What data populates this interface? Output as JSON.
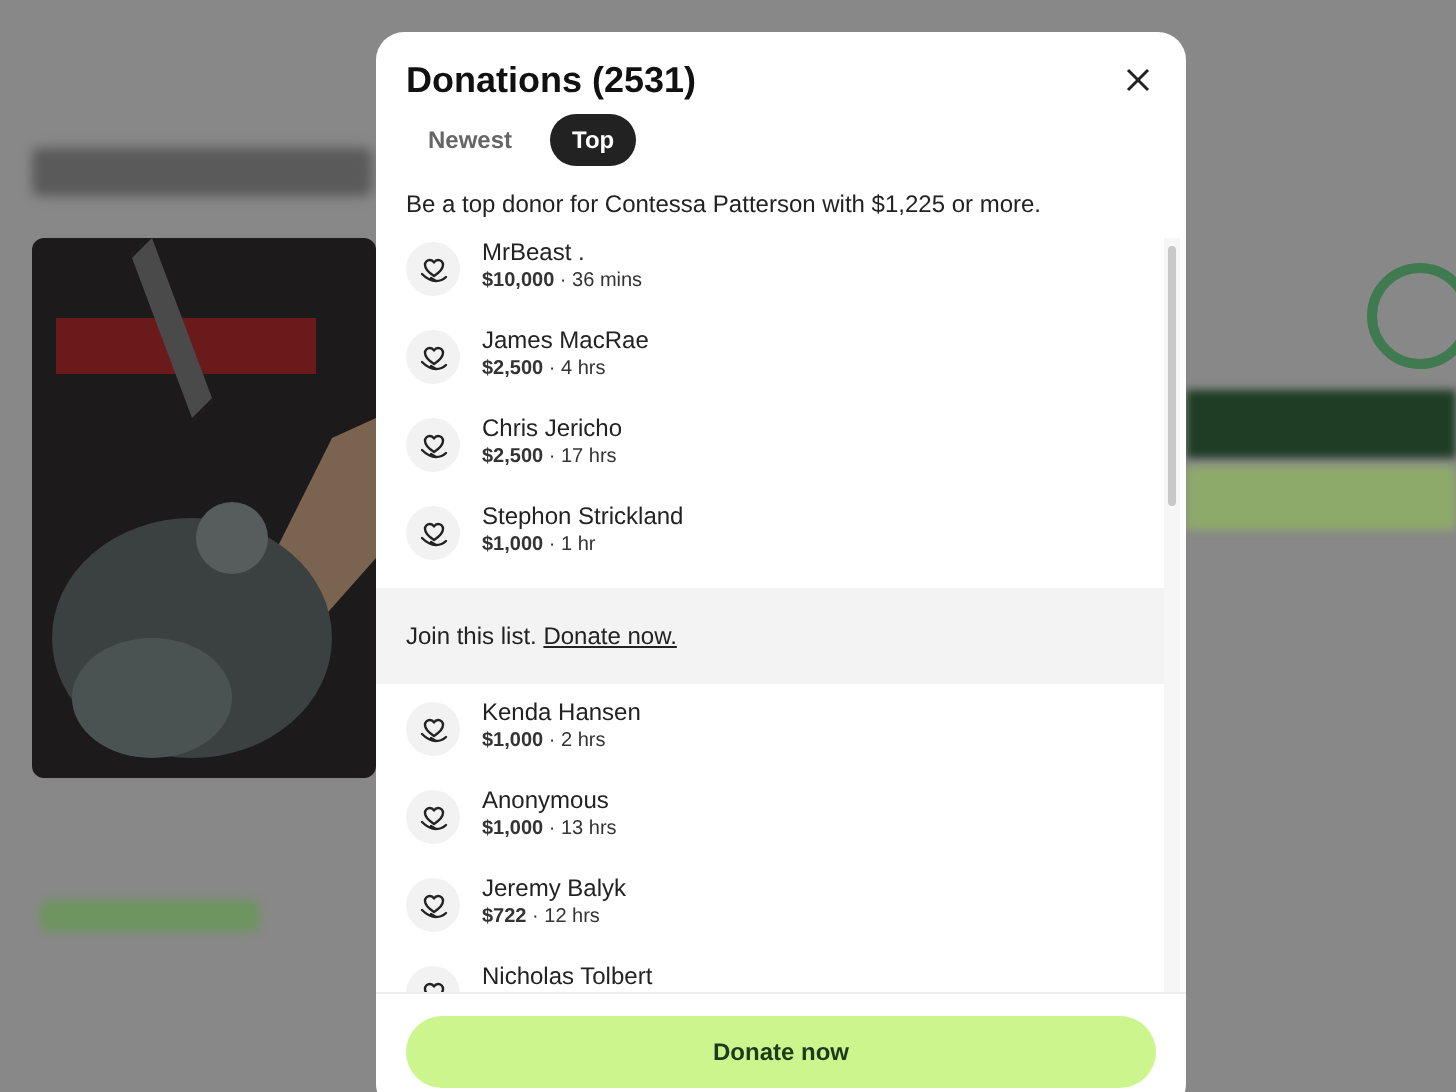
{
  "dialog": {
    "title": "Donations (2531)",
    "tabs": [
      {
        "label": "Newest",
        "selected": false
      },
      {
        "label": "Top",
        "selected": true
      }
    ],
    "description": "Be a top donor for Contessa Patterson with $1,225 or more.",
    "list": [
      {
        "kind": "donor",
        "name": "MrBeast .",
        "details": "**$10,000** · 36 mins"
      },
      {
        "kind": "donor",
        "name": "James MacRae",
        "details": "**$2,500** · 4 hrs"
      },
      {
        "kind": "donor",
        "name": "Chris Jericho",
        "details": "**$2,500** · 17 hrs"
      },
      {
        "kind": "donor",
        "name": "Stephon Strickland",
        "details": "**$1,000** · 1 hr"
      },
      {
        "kind": "join",
        "text": "Join this list.",
        "link": "Donate now."
      },
      {
        "kind": "donor",
        "name": "Kenda Hansen",
        "details": "**$1,000** · 2 hrs"
      },
      {
        "kind": "donor",
        "name": "Anonymous",
        "details": "**$1,000** · 13 hrs"
      },
      {
        "kind": "donor",
        "name": "Jeremy Balyk",
        "details": "**$722** · 12 hrs"
      },
      {
        "kind": "donor",
        "name": "Nicholas Tolbert"
      }
    ],
    "button": "Donate now"
  }
}
